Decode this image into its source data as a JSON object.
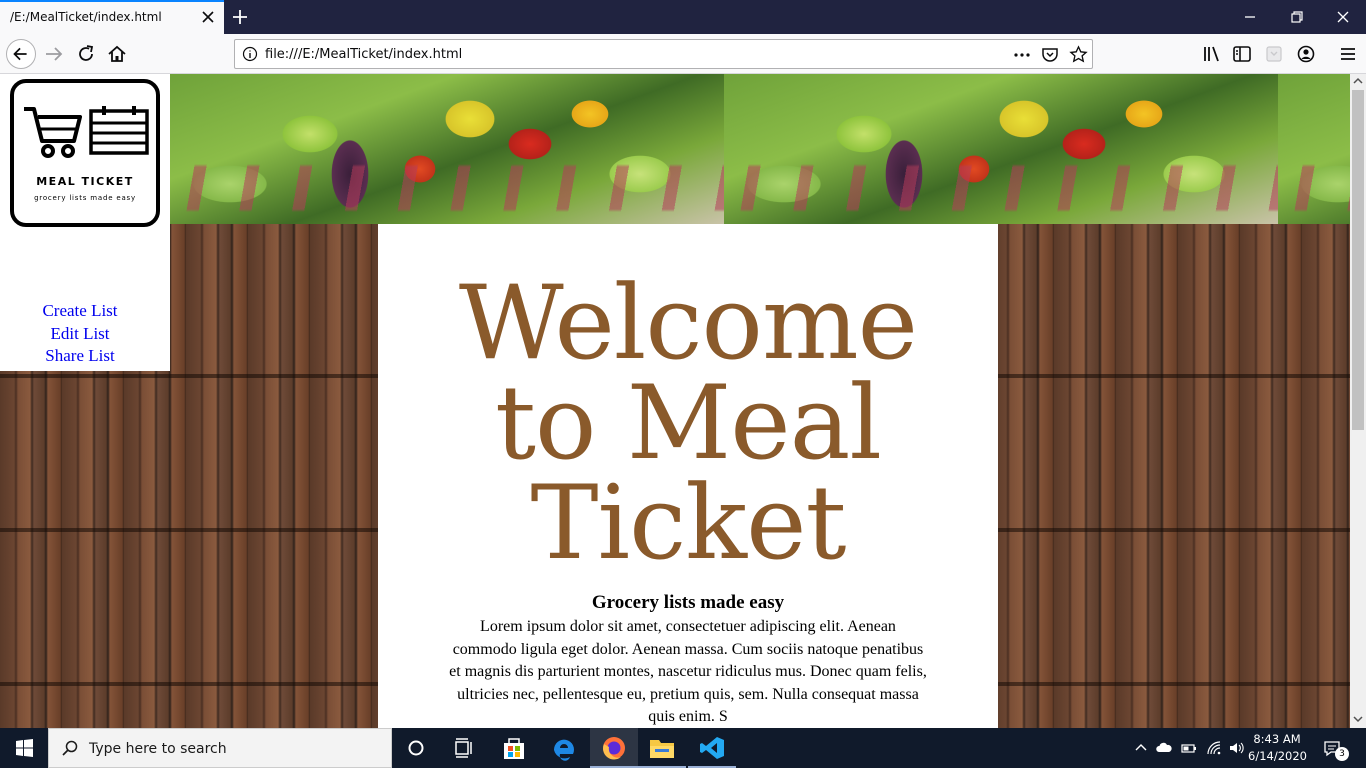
{
  "browser": {
    "tab_title": "/E:/MealTicket/index.html",
    "url": "file:///E:/MealTicket/index.html"
  },
  "icons": {
    "tab_close": "close-icon",
    "new_tab": "plus-icon",
    "back": "back-arrow-icon",
    "forward": "forward-arrow-icon",
    "reload": "reload-icon",
    "home": "home-icon",
    "page_info": "info-icon",
    "page_actions": "ellipsis-icon",
    "pocket": "pocket-icon",
    "bookmark": "star-icon",
    "library": "library-icon",
    "sidebar": "sidebar-icon",
    "account": "account-icon",
    "menu": "hamburger-menu-icon"
  },
  "logo": {
    "title": "MEAL TICKET",
    "subtitle": "grocery lists made easy"
  },
  "nav": {
    "items": [
      "Create List",
      "Edit List",
      "Share List"
    ]
  },
  "main": {
    "heading_lines": [
      "Welcome",
      "to Meal",
      "Ticket"
    ],
    "tagline": "Grocery lists made easy",
    "body": "Lorem ipsum dolor sit amet, consectetuer adipiscing elit. Aenean commodo ligula eget dolor. Aenean massa. Cum sociis natoque penatibus et magnis dis parturient montes, nascetur ridiculus mus. Donec quam felis, ultricies nec, pellentesque eu, pretium quis, sem. Nulla consequat massa quis enim. S"
  },
  "taskbar": {
    "search_placeholder": "Type here to search",
    "time": "8:43 AM",
    "date": "6/14/2020",
    "notification_count": "3"
  },
  "colors": {
    "heading": "#8a5a2b",
    "link": "#0000ee",
    "tab_accent": "#0a84ff",
    "titlebar": "#202340",
    "taskbar": "#101a2b"
  }
}
